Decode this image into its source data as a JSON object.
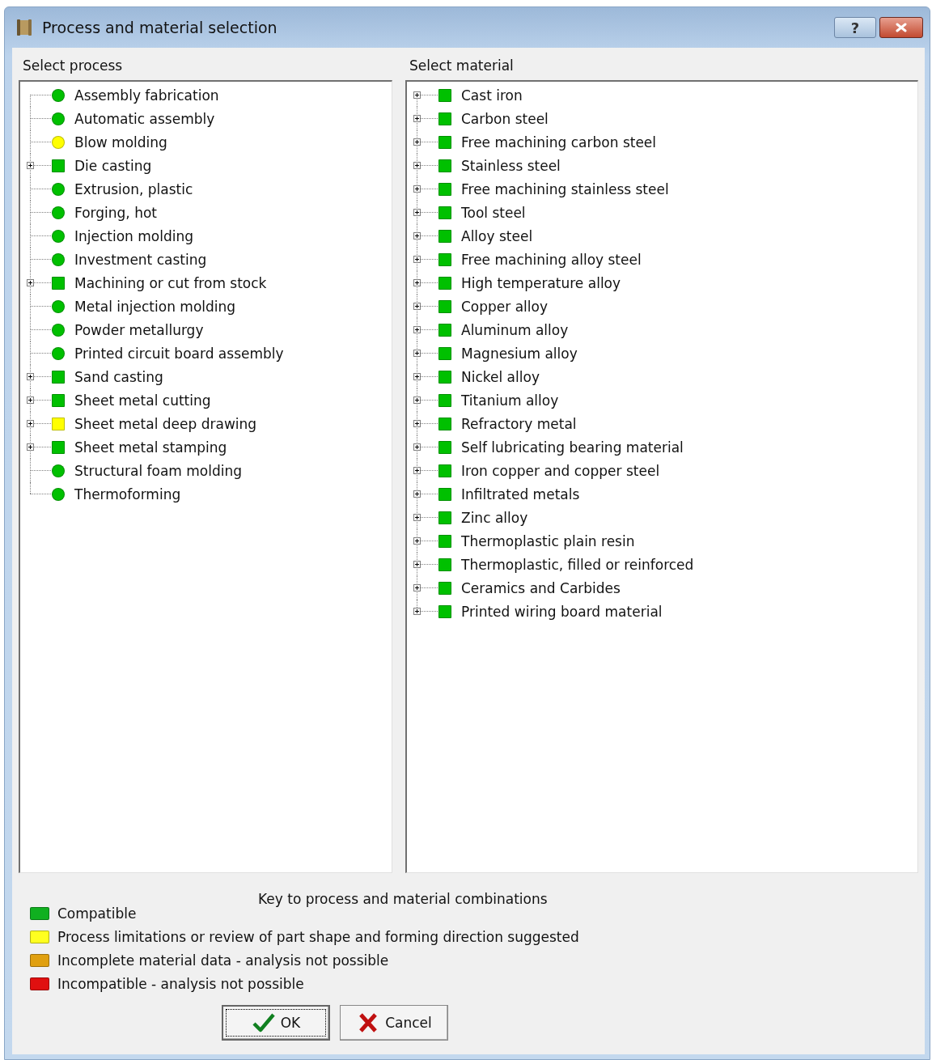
{
  "window": {
    "title": "Process and material selection",
    "buttons": [
      {
        "kind": "help",
        "label": "?"
      },
      {
        "kind": "close"
      }
    ]
  },
  "process": {
    "label": "Select process",
    "items": [
      {
        "label": "Assembly fabrication",
        "kind": "leaf",
        "color": "#00c000"
      },
      {
        "label": "Automatic assembly",
        "kind": "leaf",
        "color": "#00c000"
      },
      {
        "label": "Blow molding",
        "kind": "leaf",
        "color": "#ffff00"
      },
      {
        "label": "Die casting",
        "kind": "branch",
        "color": "#00c000"
      },
      {
        "label": "Extrusion, plastic",
        "kind": "leaf",
        "color": "#00c000"
      },
      {
        "label": "Forging, hot",
        "kind": "leaf",
        "color": "#00c000"
      },
      {
        "label": "Injection molding",
        "kind": "leaf",
        "color": "#00c000"
      },
      {
        "label": "Investment casting",
        "kind": "leaf",
        "color": "#00c000"
      },
      {
        "label": "Machining or cut from stock",
        "kind": "branch",
        "color": "#00c000"
      },
      {
        "label": "Metal injection molding",
        "kind": "leaf",
        "color": "#00c000"
      },
      {
        "label": "Powder metallurgy",
        "kind": "leaf",
        "color": "#00c000"
      },
      {
        "label": "Printed circuit board assembly",
        "kind": "leaf",
        "color": "#00c000"
      },
      {
        "label": "Sand casting",
        "kind": "branch",
        "color": "#00c000"
      },
      {
        "label": "Sheet metal cutting",
        "kind": "branch",
        "color": "#00c000"
      },
      {
        "label": "Sheet metal deep drawing",
        "kind": "branch",
        "color": "#ffff00"
      },
      {
        "label": "Sheet metal stamping",
        "kind": "branch",
        "color": "#00c000"
      },
      {
        "label": "Structural foam molding",
        "kind": "leaf",
        "color": "#00c000"
      },
      {
        "label": "Thermoforming",
        "kind": "leaf",
        "color": "#00c000"
      }
    ]
  },
  "material": {
    "label": "Select material",
    "items": [
      {
        "label": "Cast iron",
        "kind": "branch",
        "color": "#00c000"
      },
      {
        "label": "Carbon steel",
        "kind": "branch",
        "color": "#00c000"
      },
      {
        "label": "Free machining carbon steel",
        "kind": "branch",
        "color": "#00c000"
      },
      {
        "label": "Stainless steel",
        "kind": "branch",
        "color": "#00c000"
      },
      {
        "label": "Free machining stainless steel",
        "kind": "branch",
        "color": "#00c000"
      },
      {
        "label": "Tool steel",
        "kind": "branch",
        "color": "#00c000"
      },
      {
        "label": "Alloy steel",
        "kind": "branch",
        "color": "#00c000"
      },
      {
        "label": "Free machining alloy steel",
        "kind": "branch",
        "color": "#00c000"
      },
      {
        "label": "High temperature alloy",
        "kind": "branch",
        "color": "#00c000"
      },
      {
        "label": "Copper alloy",
        "kind": "branch",
        "color": "#00c000"
      },
      {
        "label": "Aluminum alloy",
        "kind": "branch",
        "color": "#00c000"
      },
      {
        "label": "Magnesium alloy",
        "kind": "branch",
        "color": "#00c000"
      },
      {
        "label": "Nickel alloy",
        "kind": "branch",
        "color": "#00c000"
      },
      {
        "label": "Titanium alloy",
        "kind": "branch",
        "color": "#00c000"
      },
      {
        "label": "Refractory metal",
        "kind": "branch",
        "color": "#00c000"
      },
      {
        "label": "Self lubricating bearing material",
        "kind": "branch",
        "color": "#00c000"
      },
      {
        "label": "Iron copper and copper steel",
        "kind": "branch",
        "color": "#00c000"
      },
      {
        "label": "Infiltrated metals",
        "kind": "branch",
        "color": "#00c000"
      },
      {
        "label": "Zinc alloy",
        "kind": "branch",
        "color": "#00c000"
      },
      {
        "label": "Thermoplastic plain resin",
        "kind": "branch",
        "color": "#00c000"
      },
      {
        "label": "Thermoplastic, filled or reinforced",
        "kind": "branch",
        "color": "#00c000"
      },
      {
        "label": "Ceramics and Carbides",
        "kind": "branch",
        "color": "#00c000"
      },
      {
        "label": "Printed wiring board material",
        "kind": "branch",
        "color": "#00c000"
      }
    ]
  },
  "key": {
    "title": "Key to process and material combinations",
    "items": [
      {
        "label": "Compatible",
        "color": "#10b020"
      },
      {
        "label": "Process limitations or review of part shape and forming direction suggested",
        "color": "#ffff20"
      },
      {
        "label": "Incomplete material data - analysis not possible",
        "color": "#e0a010"
      },
      {
        "label": "Incompatible - analysis not possible",
        "color": "#e01010"
      }
    ]
  },
  "buttons": [
    {
      "kind": "ok",
      "label": "OK",
      "focused": true
    },
    {
      "kind": "cancel",
      "label": "Cancel",
      "focused": false
    }
  ]
}
